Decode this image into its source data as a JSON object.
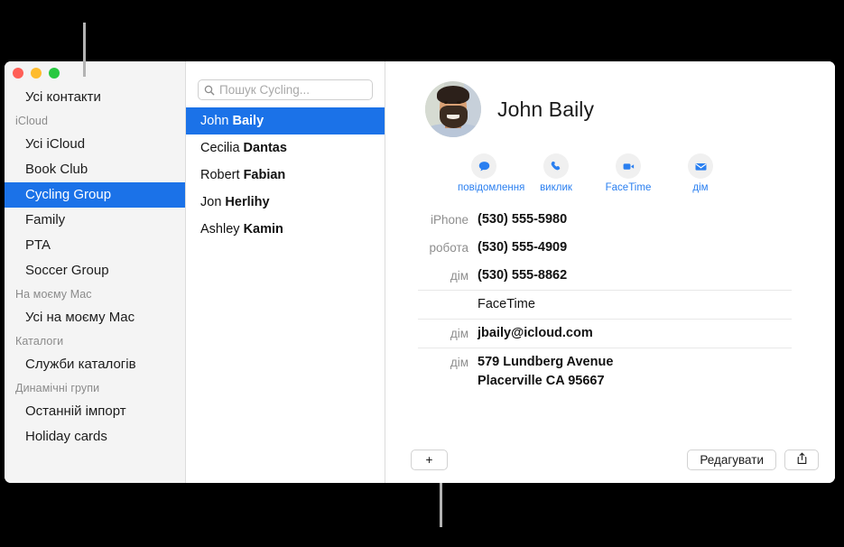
{
  "window": {
    "traffic_lights": [
      {
        "name": "close",
        "color": "#ff5f57"
      },
      {
        "name": "minimize",
        "color": "#febc2e"
      },
      {
        "name": "zoom",
        "color": "#28c840"
      }
    ]
  },
  "sidebar": {
    "top_items": [
      {
        "label": "Усі контакти",
        "selected": false
      }
    ],
    "groups": [
      {
        "header": "iCloud",
        "items": [
          {
            "label": "Усі iCloud",
            "selected": false
          },
          {
            "label": "Book Club",
            "selected": false
          },
          {
            "label": "Cycling Group",
            "selected": true
          },
          {
            "label": "Family",
            "selected": false
          },
          {
            "label": "PTA",
            "selected": false
          },
          {
            "label": "Soccer Group",
            "selected": false
          }
        ]
      },
      {
        "header": "На моєму Mac",
        "items": [
          {
            "label": "Усі на моєму Mac",
            "selected": false
          }
        ]
      },
      {
        "header": "Каталоги",
        "items": [
          {
            "label": "Служби каталогів",
            "selected": false
          }
        ]
      },
      {
        "header": "Динамічні групи",
        "items": [
          {
            "label": "Останній імпорт",
            "selected": false
          },
          {
            "label": "Holiday cards",
            "selected": false
          }
        ]
      }
    ]
  },
  "search": {
    "placeholder": "Пошук Cycling...",
    "value": "",
    "icon": "search-icon"
  },
  "contact_list": [
    {
      "first": "John ",
      "last": "Baily",
      "selected": true
    },
    {
      "first": "Cecilia ",
      "last": "Dantas",
      "selected": false
    },
    {
      "first": "Robert ",
      "last": "Fabian",
      "selected": false
    },
    {
      "first": "Jon ",
      "last": "Herlihy",
      "selected": false
    },
    {
      "first": "Ashley ",
      "last": "Kamin",
      "selected": false
    }
  ],
  "detail": {
    "name": "John Baily",
    "avatar_alt": "John Baily photo",
    "actions": [
      {
        "label": "повідомлення",
        "icon": "message-bubble-icon"
      },
      {
        "label": "виклик",
        "icon": "phone-icon"
      },
      {
        "label": "FaceTime",
        "icon": "video-camera-icon"
      },
      {
        "label": "дім",
        "icon": "envelope-icon"
      }
    ],
    "accent_color": "#2a7ff0",
    "fields": [
      {
        "label": "iPhone",
        "value": "(530) 555-5980",
        "separator": false,
        "bold": true
      },
      {
        "label": "робота",
        "value": "(530) 555-4909",
        "separator": false,
        "bold": true
      },
      {
        "label": "дім",
        "value": "(530) 555-8862",
        "separator": false,
        "bold": true
      },
      {
        "label": "",
        "value": "FaceTime",
        "separator": true,
        "bold": false
      },
      {
        "label": "дім",
        "value": "jbaily@icloud.com",
        "separator": true,
        "bold": true
      },
      {
        "label": "дім",
        "value": "579 Lundberg Avenue",
        "value2": "Placerville CA 95667",
        "separator": true,
        "bold": true
      }
    ]
  },
  "toolbar": {
    "add_label": "+",
    "edit_label": "Редагувати",
    "share_icon": "share-icon"
  }
}
